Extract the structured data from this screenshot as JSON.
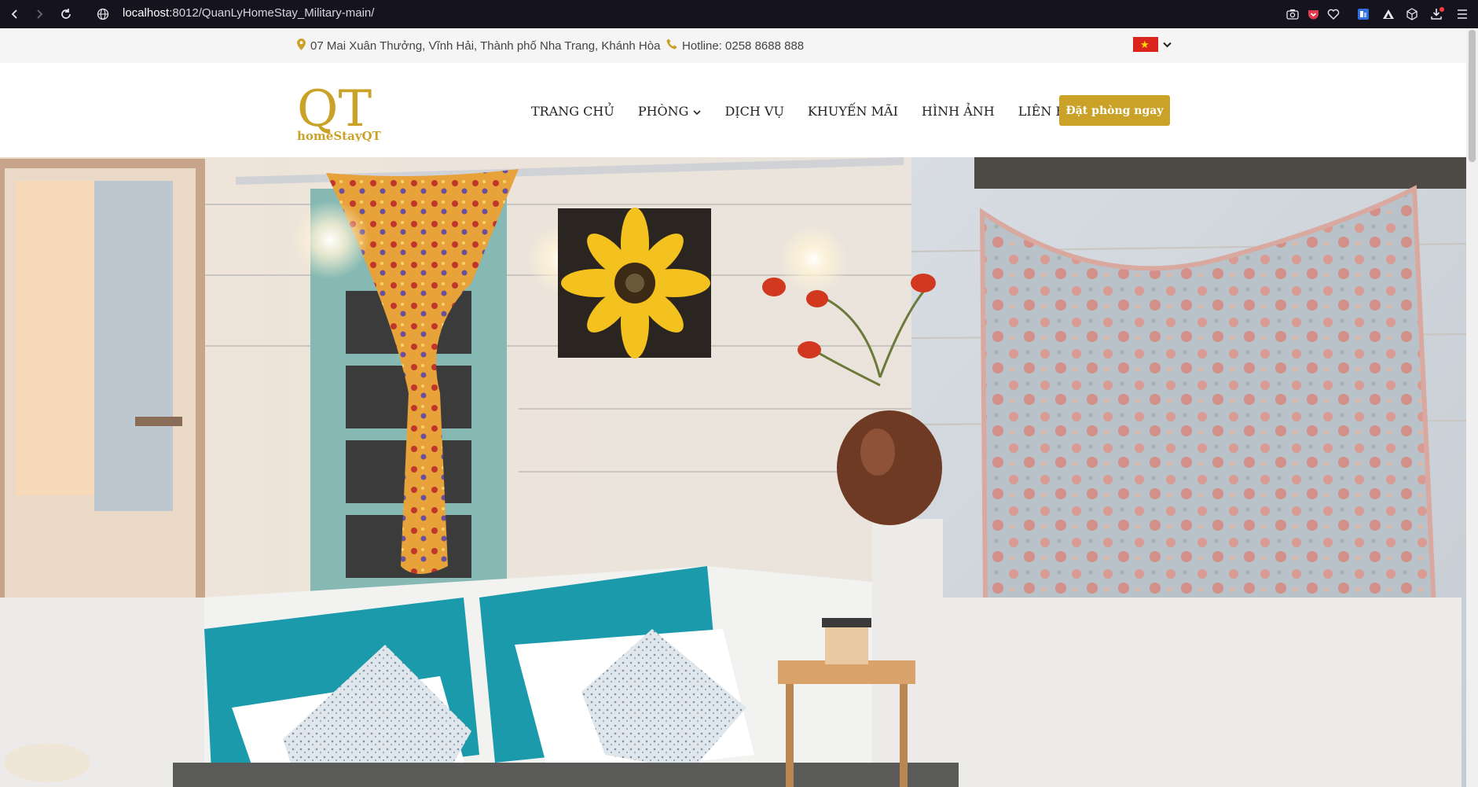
{
  "browser": {
    "url_host": "localhost",
    "url_rest": ":8012/QuanLyHomeStay_Military-main/"
  },
  "topbar": {
    "address": "07 Mai Xuân Thưởng, Vĩnh Hải, Thành phố Nha Trang, Khánh Hòa",
    "hotline": "Hotline: 0258 8688 888",
    "flag_star": "★"
  },
  "logo": {
    "letters": "QT",
    "tagline": "homeStayQT"
  },
  "nav": {
    "items": [
      "TRANG CHỦ",
      "PHÒNG",
      "DỊCH VỤ",
      "KHUYẾN MÃI",
      "HÌNH ẢNH",
      "LIÊN HỆ"
    ],
    "book_label": "Đặt phòng ngay"
  },
  "colors": {
    "accent": "#c9a227",
    "chrome": "#15131e",
    "topbar_bg": "#f5f5f5"
  },
  "icons": [
    "back-icon",
    "forward-icon",
    "reload-icon",
    "site-info-icon",
    "camera-icon",
    "pocket-icon",
    "heart-icon",
    "extension-icon",
    "triangle-icon",
    "cube-icon",
    "download-icon",
    "menu-icon",
    "map-marker-icon",
    "phone-icon",
    "chevron-down-icon"
  ]
}
